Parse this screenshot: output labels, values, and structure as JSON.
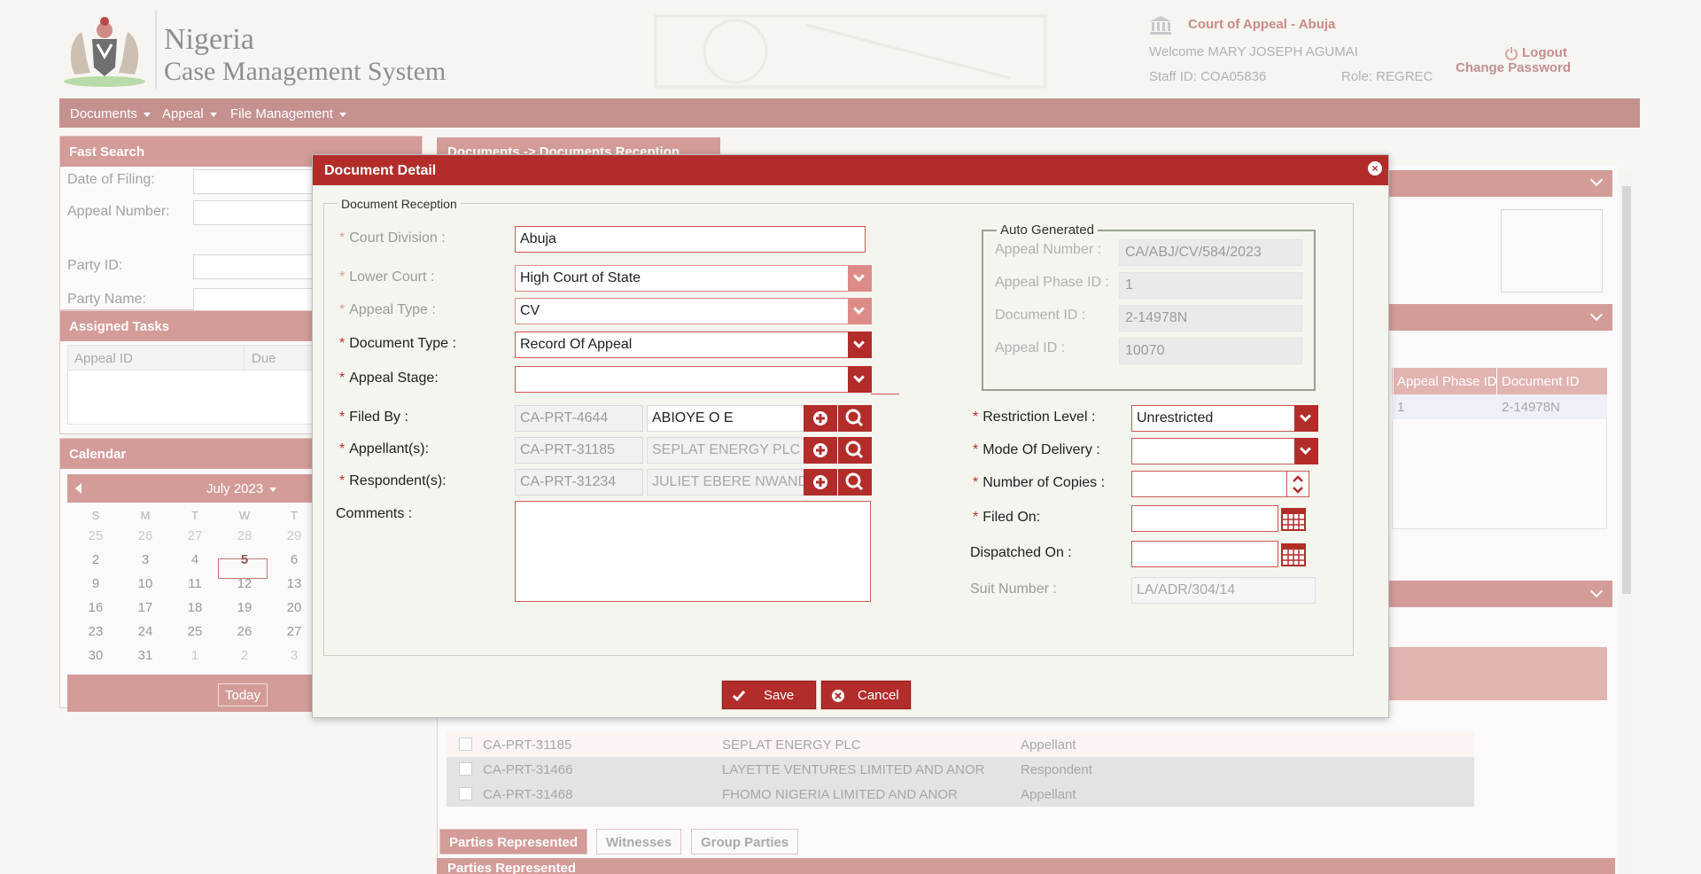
{
  "header": {
    "brand_line1": "Nigeria",
    "brand_line2": "Case Management System",
    "court": "Court of Appeal - Abuja",
    "welcome": "Welcome MARY JOSEPH AGUMAI",
    "staff_id": "Staff ID: COA05836",
    "role": "Role: REGREC",
    "logout": "Logout",
    "change_password": "Change Password"
  },
  "menu": [
    "Documents",
    "Appeal",
    "File Management"
  ],
  "fast_search": {
    "title": "Fast Search",
    "fields": [
      "Date of Filing:",
      "Appeal Number:",
      "Party ID:",
      "Party Name:"
    ]
  },
  "assigned_tasks": {
    "title": "Assigned Tasks",
    "columns": [
      "Appeal ID",
      "Due"
    ]
  },
  "calendar": {
    "title": "Calendar",
    "month": "July 2023",
    "dow": [
      "S",
      "M",
      "T",
      "W",
      "T"
    ],
    "rows": [
      [
        "25",
        "26",
        "27",
        "28",
        "29"
      ],
      [
        "2",
        "3",
        "4",
        "5",
        "6"
      ],
      [
        "9",
        "10",
        "11",
        "12",
        "13"
      ],
      [
        "16",
        "17",
        "18",
        "19",
        "20"
      ],
      [
        "23",
        "24",
        "25",
        "26",
        "27"
      ],
      [
        "30",
        "31",
        "1",
        "2",
        "3"
      ]
    ],
    "today_button": "Today"
  },
  "breadcrumb_tab": "Documents -> Documents Reception",
  "bg_grid": {
    "columns": [
      "Appeal Phase ID",
      "Document ID"
    ],
    "row": [
      "1",
      "2-14978N"
    ]
  },
  "bg_parties": [
    [
      "CA-PRT-31185",
      "SEPLAT ENERGY PLC",
      "Appellant"
    ],
    [
      "CA-PRT-31466",
      "LAYETTE VENTURES LIMITED AND ANOR",
      "Respondent"
    ],
    [
      "CA-PRT-31468",
      "FHOMO NIGERIA LIMITED AND ANOR",
      "Appellant"
    ]
  ],
  "bottom_tabs": [
    "Parties Represented",
    "Witnesses",
    "Group Parties"
  ],
  "bottom_subtitle": "Parties Represented",
  "modal": {
    "title": "Document Detail",
    "fieldset": "Document Reception",
    "court_division": {
      "label": "Court Division :",
      "value": "Abuja"
    },
    "lower_court": {
      "label": "Lower Court :",
      "value": "High Court of State"
    },
    "appeal_type": {
      "label": "Appeal Type :",
      "value": "CV"
    },
    "document_type": {
      "label": "Document Type :",
      "value": "Record Of Appeal"
    },
    "appeal_stage": {
      "label": "Appeal Stage:",
      "value": ""
    },
    "filed_by": {
      "label": "Filed By :",
      "id": "CA-PRT-4644",
      "name": "ABIOYE O E"
    },
    "appellants": {
      "label": "Appellant(s):",
      "id": "CA-PRT-31185",
      "name": "SEPLAT ENERGY PLC"
    },
    "respondents": {
      "label": "Respondent(s):",
      "id": "CA-PRT-31234",
      "name": "JULIET EBERE NWANDU"
    },
    "comments": {
      "label": "Comments :"
    },
    "auto_generated": {
      "title": "Auto Generated",
      "appeal_number": {
        "label": "Appeal Number :",
        "value": "CA/ABJ/CV/584/2023"
      },
      "appeal_phase_id": {
        "label": "Appeal Phase ID :",
        "value": "1"
      },
      "document_id": {
        "label": "Document ID :",
        "value": "2-14978N"
      },
      "appeal_id": {
        "label": "Appeal ID :",
        "value": "10070"
      }
    },
    "restriction_level": {
      "label": "Restriction Level :",
      "value": "Unrestricted"
    },
    "mode_of_delivery": {
      "label": "Mode Of Delivery :",
      "value": ""
    },
    "number_of_copies": {
      "label": "Number of Copies :",
      "value": ""
    },
    "filed_on": {
      "label": "Filed On:",
      "value": ""
    },
    "dispatched_on": {
      "label": "Dispatched On :",
      "value": ""
    },
    "suit_number": {
      "label": "Suit Number :",
      "value": "LA/ADR/304/14"
    },
    "save": "Save",
    "cancel": "Cancel"
  },
  "colors": {
    "accent": "#b22d2a",
    "menu": "#c4918f",
    "panel_title": "#d39c99"
  }
}
